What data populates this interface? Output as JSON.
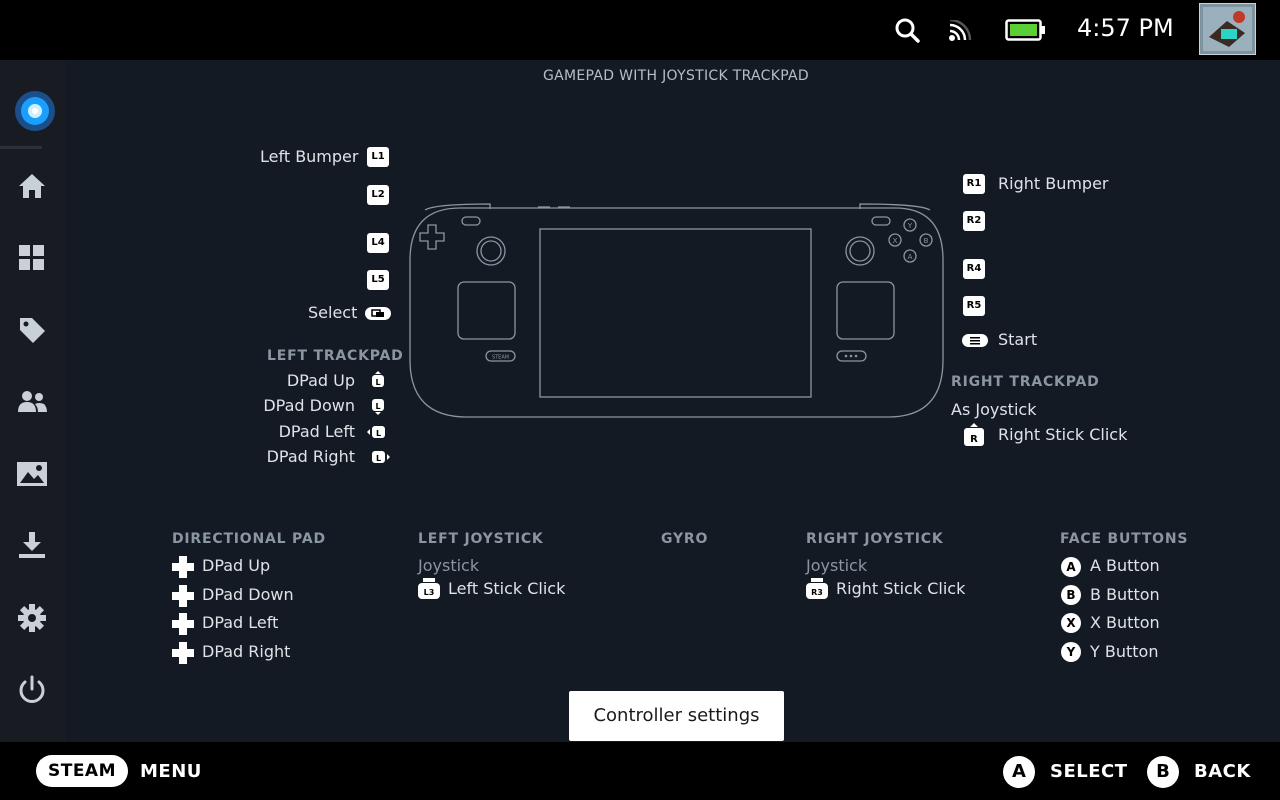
{
  "status_bar": {
    "time": "4:57 PM"
  },
  "page": {
    "title": "GAMEPAD WITH JOYSTICK TRACKPAD"
  },
  "sidebar": {
    "items": [
      {
        "icon": "steam-logo-icon"
      },
      {
        "icon": "home-icon"
      },
      {
        "icon": "library-grid-icon"
      },
      {
        "icon": "store-tag-icon"
      },
      {
        "icon": "friends-icon"
      },
      {
        "icon": "media-icon"
      },
      {
        "icon": "downloads-icon"
      },
      {
        "icon": "settings-gear-icon"
      },
      {
        "icon": "power-icon"
      }
    ]
  },
  "left_mappings": {
    "left_bumper": {
      "label": "Left Bumper",
      "key": "L1"
    },
    "l2": {
      "key": "L2"
    },
    "l4": {
      "key": "L4"
    },
    "l5": {
      "key": "L5"
    },
    "select": {
      "label": "Select"
    }
  },
  "left_trackpad": {
    "header": "LEFT TRACKPAD",
    "items": [
      "DPad Up",
      "DPad Down",
      "DPad Left",
      "DPad Right"
    ]
  },
  "right_mappings": {
    "right_bumper": {
      "label": "Right Bumper",
      "key": "R1"
    },
    "r2": {
      "key": "R2"
    },
    "r4": {
      "key": "R4"
    },
    "r5": {
      "key": "R5"
    },
    "start": {
      "label": "Start"
    }
  },
  "right_trackpad": {
    "header": "RIGHT TRACKPAD",
    "mode": "As Joystick",
    "click": {
      "label": "Right Stick Click",
      "key": "R"
    }
  },
  "device": {
    "steam_button_label": "STEAM",
    "face_letters": [
      "Y",
      "X",
      "B",
      "A"
    ]
  },
  "sections": {
    "directional_pad": {
      "header": "DIRECTIONAL PAD",
      "items": [
        "DPad Up",
        "DPad Down",
        "DPad Left",
        "DPad Right"
      ]
    },
    "left_joystick": {
      "header": "LEFT JOYSTICK",
      "mode": "Joystick",
      "click_key": "L3",
      "click_label": "Left Stick Click"
    },
    "gyro": {
      "header": "GYRO"
    },
    "right_joystick": {
      "header": "RIGHT JOYSTICK",
      "mode": "Joystick",
      "click_key": "R3",
      "click_label": "Right Stick Click"
    },
    "face_buttons": {
      "header": "FACE BUTTONS",
      "items": [
        {
          "key": "A",
          "label": "A Button"
        },
        {
          "key": "B",
          "label": "B Button"
        },
        {
          "key": "X",
          "label": "X Button"
        },
        {
          "key": "Y",
          "label": "Y Button"
        }
      ]
    }
  },
  "controller_settings_button": "Controller settings",
  "bottom_bar": {
    "steam_label": "STEAM",
    "menu_label": "MENU",
    "select_key": "A",
    "select_label": "SELECT",
    "back_key": "B",
    "back_label": "BACK"
  },
  "colors": {
    "accent_blue": "#1a9fff",
    "battery_green": "#5ad035"
  }
}
